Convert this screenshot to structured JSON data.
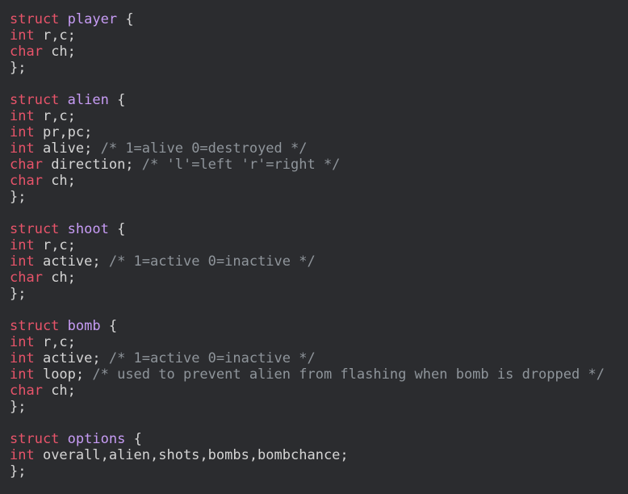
{
  "colors": {
    "background": "#2b2c2f",
    "keyword": "#e8546a",
    "struct_name": "#c79cf5",
    "text": "#d5d5d5",
    "comment": "#8f959b"
  },
  "lines": [
    {
      "tokens": [
        {
          "t": "kw",
          "v": "struct"
        },
        {
          "t": "plain",
          "v": " "
        },
        {
          "t": "name",
          "v": "player"
        },
        {
          "t": "plain",
          "v": " {"
        }
      ]
    },
    {
      "tokens": [
        {
          "t": "kw",
          "v": "int"
        },
        {
          "t": "plain",
          "v": " r,c;"
        }
      ]
    },
    {
      "tokens": [
        {
          "t": "kw",
          "v": "char"
        },
        {
          "t": "plain",
          "v": " ch;"
        }
      ]
    },
    {
      "tokens": [
        {
          "t": "plain",
          "v": "};"
        }
      ]
    },
    {
      "tokens": []
    },
    {
      "tokens": [
        {
          "t": "kw",
          "v": "struct"
        },
        {
          "t": "plain",
          "v": " "
        },
        {
          "t": "name",
          "v": "alien"
        },
        {
          "t": "plain",
          "v": " {"
        }
      ]
    },
    {
      "tokens": [
        {
          "t": "kw",
          "v": "int"
        },
        {
          "t": "plain",
          "v": " r,c;"
        }
      ]
    },
    {
      "tokens": [
        {
          "t": "kw",
          "v": "int"
        },
        {
          "t": "plain",
          "v": " pr,pc;"
        }
      ]
    },
    {
      "tokens": [
        {
          "t": "kw",
          "v": "int"
        },
        {
          "t": "plain",
          "v": " alive; "
        },
        {
          "t": "comment",
          "v": "/* 1=alive 0=destroyed */"
        }
      ]
    },
    {
      "tokens": [
        {
          "t": "kw",
          "v": "char"
        },
        {
          "t": "plain",
          "v": " direction; "
        },
        {
          "t": "comment",
          "v": "/* 'l'=left 'r'=right */"
        }
      ]
    },
    {
      "tokens": [
        {
          "t": "kw",
          "v": "char"
        },
        {
          "t": "plain",
          "v": " ch;"
        }
      ]
    },
    {
      "tokens": [
        {
          "t": "plain",
          "v": "};"
        }
      ]
    },
    {
      "tokens": []
    },
    {
      "tokens": [
        {
          "t": "kw",
          "v": "struct"
        },
        {
          "t": "plain",
          "v": " "
        },
        {
          "t": "name",
          "v": "shoot"
        },
        {
          "t": "plain",
          "v": " {"
        }
      ]
    },
    {
      "tokens": [
        {
          "t": "kw",
          "v": "int"
        },
        {
          "t": "plain",
          "v": " r,c;"
        }
      ]
    },
    {
      "tokens": [
        {
          "t": "kw",
          "v": "int"
        },
        {
          "t": "plain",
          "v": " active; "
        },
        {
          "t": "comment",
          "v": "/* 1=active 0=inactive */"
        }
      ]
    },
    {
      "tokens": [
        {
          "t": "kw",
          "v": "char"
        },
        {
          "t": "plain",
          "v": " ch;"
        }
      ]
    },
    {
      "tokens": [
        {
          "t": "plain",
          "v": "};"
        }
      ]
    },
    {
      "tokens": []
    },
    {
      "tokens": [
        {
          "t": "kw",
          "v": "struct"
        },
        {
          "t": "plain",
          "v": " "
        },
        {
          "t": "name",
          "v": "bomb"
        },
        {
          "t": "plain",
          "v": " {"
        }
      ]
    },
    {
      "tokens": [
        {
          "t": "kw",
          "v": "int"
        },
        {
          "t": "plain",
          "v": " r,c;"
        }
      ]
    },
    {
      "tokens": [
        {
          "t": "kw",
          "v": "int"
        },
        {
          "t": "plain",
          "v": " active; "
        },
        {
          "t": "comment",
          "v": "/* 1=active 0=inactive */"
        }
      ]
    },
    {
      "tokens": [
        {
          "t": "kw",
          "v": "int"
        },
        {
          "t": "plain",
          "v": " loop; "
        },
        {
          "t": "comment",
          "v": "/* used to prevent alien from flashing when bomb is dropped */"
        }
      ]
    },
    {
      "tokens": [
        {
          "t": "kw",
          "v": "char"
        },
        {
          "t": "plain",
          "v": " ch;"
        }
      ]
    },
    {
      "tokens": [
        {
          "t": "plain",
          "v": "};"
        }
      ]
    },
    {
      "tokens": []
    },
    {
      "tokens": [
        {
          "t": "kw",
          "v": "struct"
        },
        {
          "t": "plain",
          "v": " "
        },
        {
          "t": "name",
          "v": "options"
        },
        {
          "t": "plain",
          "v": " {"
        }
      ]
    },
    {
      "tokens": [
        {
          "t": "kw",
          "v": "int"
        },
        {
          "t": "plain",
          "v": " overall,alien,shots,bombs,bombchance;"
        }
      ]
    },
    {
      "tokens": [
        {
          "t": "plain",
          "v": "};"
        }
      ]
    }
  ]
}
